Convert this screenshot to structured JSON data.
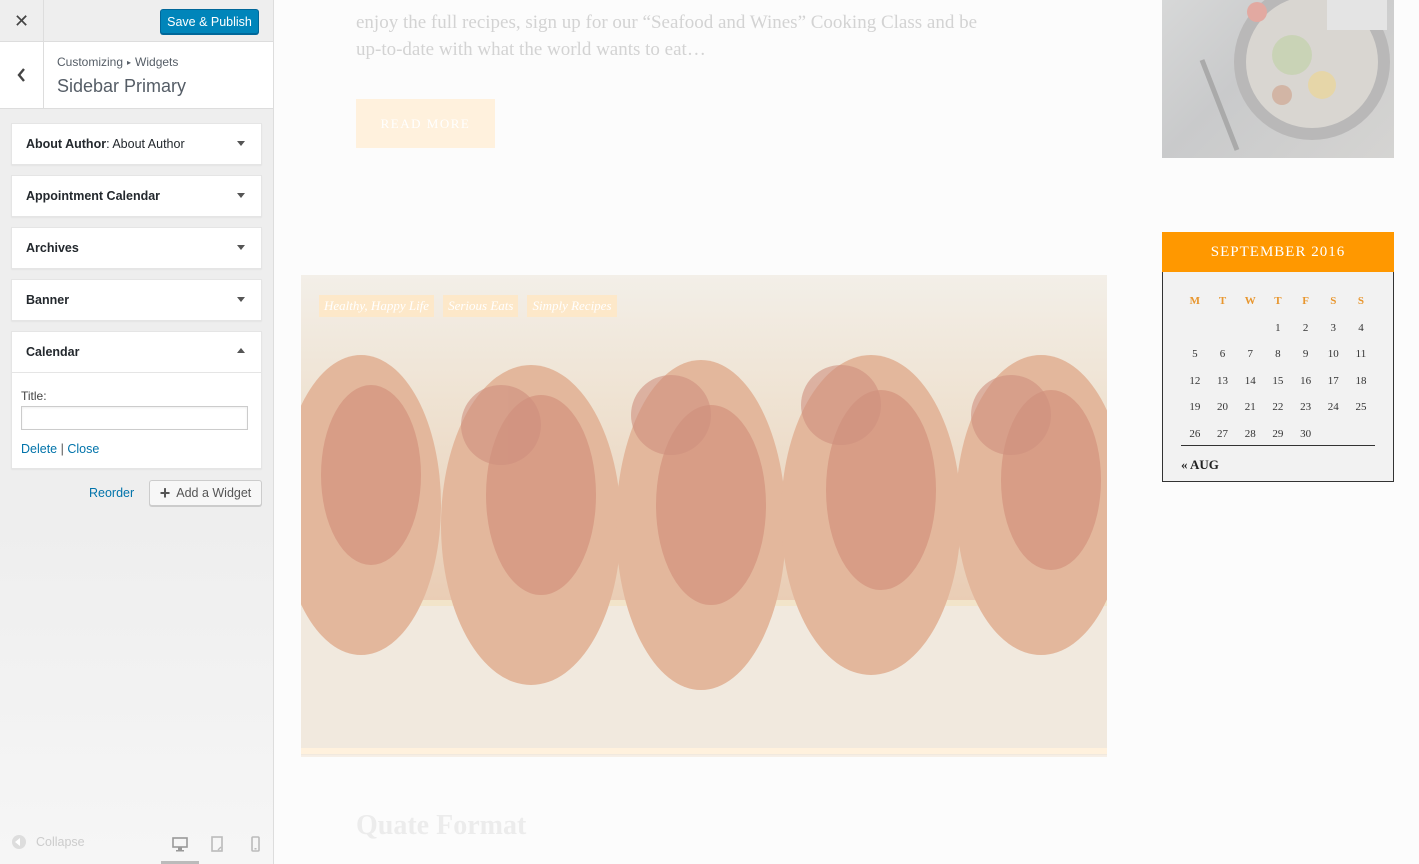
{
  "customizer": {
    "close_glyph": "✕",
    "publish_label": "Save & Publish",
    "breadcrumb": {
      "root": "Customizing",
      "separator": "▸",
      "current": "Widgets"
    },
    "section_title": "Sidebar Primary",
    "widgets": [
      {
        "name": "About Author",
        "subtitle": ": About Author",
        "expanded": false
      },
      {
        "name": "Appointment Calendar",
        "subtitle": "",
        "expanded": false
      },
      {
        "name": "Archives",
        "subtitle": "",
        "expanded": false
      },
      {
        "name": "Banner",
        "subtitle": "",
        "expanded": false
      },
      {
        "name": "Calendar",
        "subtitle": "",
        "expanded": true
      }
    ],
    "calendar_form": {
      "title_label": "Title:",
      "title_value": "",
      "delete_label": "Delete",
      "link_separator": "|",
      "close_label": "Close"
    },
    "reorder_label": "Reorder",
    "add_widget_label": "Add a Widget",
    "collapse_label": "Collapse",
    "devices": [
      "desktop-icon",
      "tablet-icon",
      "mobile-icon"
    ]
  },
  "preview": {
    "excerpt_lines": [
      "enjoy the full recipes, sign up for our “Seafood and Wines” Cooking Class and be",
      "up-to-date with what the world wants to eat…"
    ],
    "read_more_label": "READ MORE",
    "post_tags": [
      "Healthy, Happy Life",
      "Serious Eats",
      "Simply Recipes"
    ],
    "next_post_title": "Quate Format",
    "calendar": {
      "month_label": "SEPTEMBER 2016",
      "weekdays": [
        "M",
        "T",
        "W",
        "T",
        "F",
        "S",
        "S"
      ],
      "weeks": [
        [
          "",
          "",
          "",
          "1",
          "2",
          "3",
          "4"
        ],
        [
          "5",
          "6",
          "7",
          "8",
          "9",
          "10",
          "11"
        ],
        [
          "12",
          "13",
          "14",
          "15",
          "16",
          "17",
          "18"
        ],
        [
          "19",
          "20",
          "21",
          "22",
          "23",
          "24",
          "25"
        ],
        [
          "26",
          "27",
          "28",
          "29",
          "30",
          "",
          ""
        ]
      ],
      "prev_label": "« AUG"
    },
    "colors": {
      "accent": "#ff9800",
      "primary_button": "#0085ba",
      "link": "#0073aa"
    }
  }
}
